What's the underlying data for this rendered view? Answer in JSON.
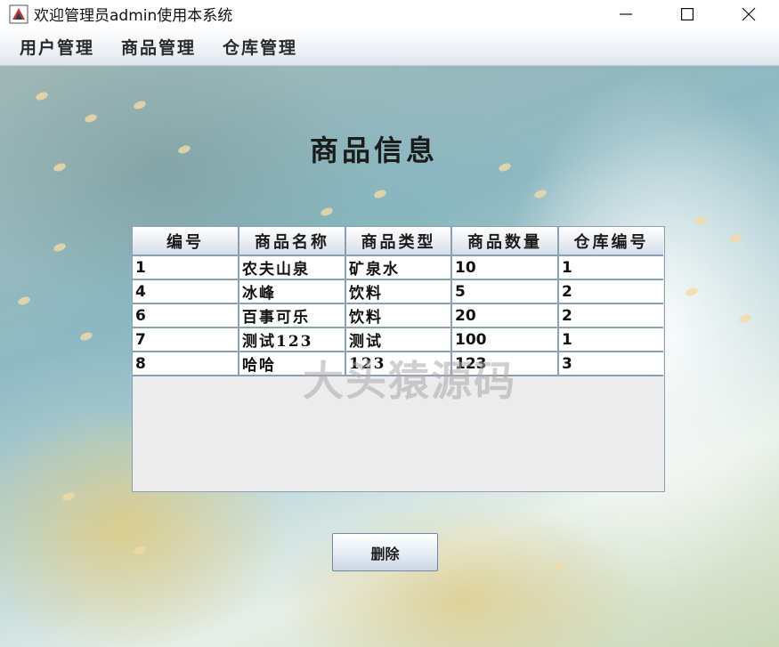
{
  "window": {
    "title": "欢迎管理员admin使用本系统"
  },
  "menu": {
    "items": [
      "用户管理",
      "商品管理",
      "仓库管理"
    ]
  },
  "page": {
    "title": "商品信息"
  },
  "table": {
    "columns": [
      "编号",
      "商品名称",
      "商品类型",
      "商品数量",
      "仓库编号"
    ],
    "rows": [
      [
        "1",
        "农夫山泉",
        "矿泉水",
        "10",
        "1"
      ],
      [
        "4",
        "冰峰",
        "饮料",
        "5",
        "2"
      ],
      [
        "6",
        "百事可乐",
        "饮料",
        "20",
        "2"
      ],
      [
        "7",
        "测试123",
        "测试",
        "100",
        "1"
      ],
      [
        "8",
        "哈哈",
        "123",
        "123",
        "3"
      ]
    ]
  },
  "watermark": "大头猿源码",
  "actions": {
    "delete_label": "删除"
  },
  "colors": {
    "header_border": "#8aa0b4",
    "button_border": "#6f88a3"
  }
}
